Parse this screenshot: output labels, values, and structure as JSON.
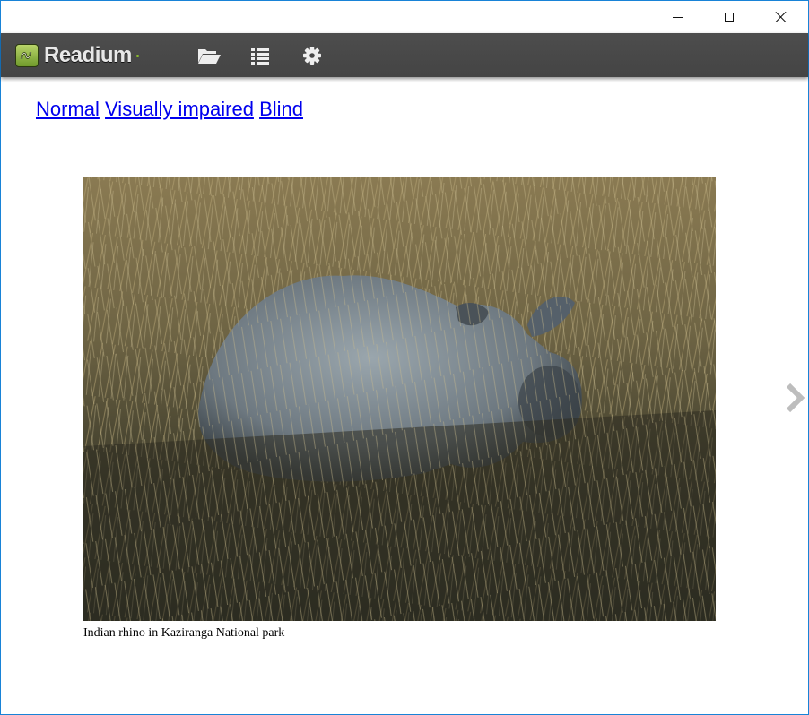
{
  "window": {
    "controls": {
      "minimize_icon": "minimize-icon",
      "maximize_icon": "maximize-icon",
      "close_icon": "close-icon"
    }
  },
  "toolbar": {
    "app_name": "Readium",
    "icons": [
      "folder-open-icon",
      "list-icon",
      "gear-icon"
    ]
  },
  "content": {
    "style_links": [
      "Normal",
      "Visually impaired",
      "Blind"
    ],
    "figure_caption": "Indian rhino in Kaziranga National park"
  },
  "navigation": {
    "next_icon": "chevron-right-icon"
  },
  "colors": {
    "toolbar_bg": "#474747",
    "link": "#0000ee",
    "window_border": "#1883d7",
    "logo_green": "#8bbf2a"
  }
}
